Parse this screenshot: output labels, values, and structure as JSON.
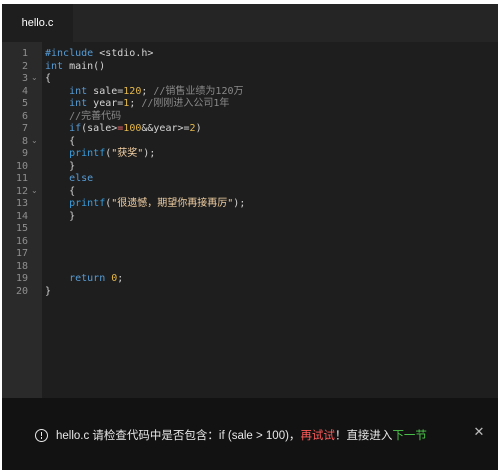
{
  "tab": {
    "filename": "hello.c"
  },
  "editor": {
    "line_numbers": [
      "1",
      "2",
      "3",
      "4",
      "5",
      "6",
      "7",
      "8",
      "9",
      "10",
      "11",
      "12",
      "13",
      "14",
      "15",
      "16",
      "17",
      "18",
      "19",
      "20"
    ],
    "fold_markers": [
      "⌄",
      "⌄",
      "⌄"
    ],
    "lines": [
      [
        {
          "c": "kw",
          "t": "#include"
        },
        {
          "c": "plain",
          "t": " <stdio.h>"
        }
      ],
      [
        {
          "c": "kw",
          "t": "int"
        },
        {
          "c": "plain",
          "t": " main()"
        }
      ],
      [
        {
          "c": "plain",
          "t": "{"
        }
      ],
      [
        {
          "c": "plain",
          "t": "    "
        },
        {
          "c": "kw",
          "t": "int"
        },
        {
          "c": "plain",
          "t": " sale="
        },
        {
          "c": "num",
          "t": "120"
        },
        {
          "c": "plain",
          "t": "; "
        },
        {
          "c": "cmt",
          "t": "//销售业绩为120万"
        }
      ],
      [
        {
          "c": "plain",
          "t": "    "
        },
        {
          "c": "kw",
          "t": "int"
        },
        {
          "c": "plain",
          "t": " year="
        },
        {
          "c": "num",
          "t": "1"
        },
        {
          "c": "plain",
          "t": "; "
        },
        {
          "c": "cmt",
          "t": "//刚刚进入公司1年"
        }
      ],
      [
        {
          "c": "plain",
          "t": "    "
        },
        {
          "c": "cmt",
          "t": "//完善代码"
        }
      ],
      [
        {
          "c": "plain",
          "t": "    "
        },
        {
          "c": "kw",
          "t": "if"
        },
        {
          "c": "plain",
          "t": "(sale>"
        },
        {
          "c": "op",
          "t": "="
        },
        {
          "c": "num",
          "t": "100"
        },
        {
          "c": "plain",
          "t": "&&year>="
        },
        {
          "c": "num",
          "t": "2"
        },
        {
          "c": "plain",
          "t": ")"
        }
      ],
      [
        {
          "c": "plain",
          "t": "    {"
        }
      ],
      [
        {
          "c": "plain",
          "t": "    "
        },
        {
          "c": "fn",
          "t": "printf"
        },
        {
          "c": "plain",
          "t": "("
        },
        {
          "c": "str",
          "t": "\"获奖\""
        },
        {
          "c": "plain",
          "t": ");"
        }
      ],
      [
        {
          "c": "plain",
          "t": "    }"
        }
      ],
      [
        {
          "c": "plain",
          "t": "    "
        },
        {
          "c": "kw",
          "t": "else"
        }
      ],
      [
        {
          "c": "plain",
          "t": "    {"
        }
      ],
      [
        {
          "c": "plain",
          "t": "    "
        },
        {
          "c": "fn",
          "t": "printf"
        },
        {
          "c": "plain",
          "t": "("
        },
        {
          "c": "str",
          "t": "\"很遗憾，期望你再接再厉\""
        },
        {
          "c": "plain",
          "t": ");"
        }
      ],
      [
        {
          "c": "plain",
          "t": "    }"
        }
      ],
      [],
      [],
      [],
      [],
      [
        {
          "c": "plain",
          "t": "    "
        },
        {
          "c": "kw",
          "t": "return"
        },
        {
          "c": "plain",
          "t": " "
        },
        {
          "c": "num",
          "t": "0"
        },
        {
          "c": "plain",
          "t": ";"
        }
      ],
      [
        {
          "c": "plain",
          "t": "}"
        }
      ]
    ]
  },
  "notification": {
    "icon": "info-icon",
    "text_main": "hello.c 请检查代码中是否包含：if (sale > 100)，",
    "retry": "再试试",
    "punct": "！",
    "goto": "直接进入",
    "next_link": "下一节",
    "close": "✕"
  },
  "colors": {
    "background": "#1e1e1e",
    "gutter": "#2a2a2b",
    "keyword": "#569cd6",
    "number": "#e5b84b",
    "comment": "#8a8a8a",
    "retry": "#ff5a5a",
    "next_link": "#4ec94e"
  }
}
